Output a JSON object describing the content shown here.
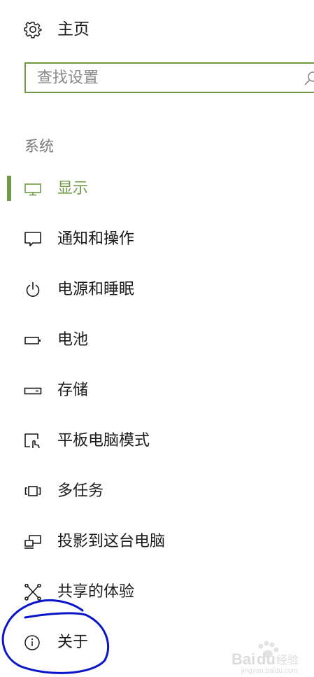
{
  "home": {
    "label": "主页",
    "icon": "gear-icon"
  },
  "search": {
    "placeholder": "查找设置",
    "icon": "search-icon"
  },
  "section": {
    "title": "系统"
  },
  "accent_color": "#6f9a46",
  "annotation_color": "#0a14c8",
  "nav": [
    {
      "label": "显示",
      "icon": "monitor-icon",
      "active": true
    },
    {
      "label": "通知和操作",
      "icon": "notification-icon",
      "active": false
    },
    {
      "label": "电源和睡眠",
      "icon": "power-icon",
      "active": false
    },
    {
      "label": "电池",
      "icon": "battery-icon",
      "active": false
    },
    {
      "label": "存储",
      "icon": "storage-drive-icon",
      "active": false
    },
    {
      "label": "平板电脑模式",
      "icon": "tablet-mode-icon",
      "active": false
    },
    {
      "label": "多任务",
      "icon": "multitasking-icon",
      "active": false
    },
    {
      "label": "投影到这台电脑",
      "icon": "projecting-icon",
      "active": false
    },
    {
      "label": "共享的体验",
      "icon": "shared-experiences-icon",
      "active": false
    },
    {
      "label": "关于",
      "icon": "info-icon",
      "active": false
    }
  ],
  "watermark": {
    "brand": "Baidu",
    "text": "经验",
    "url": "jingyan.baidu.com"
  }
}
